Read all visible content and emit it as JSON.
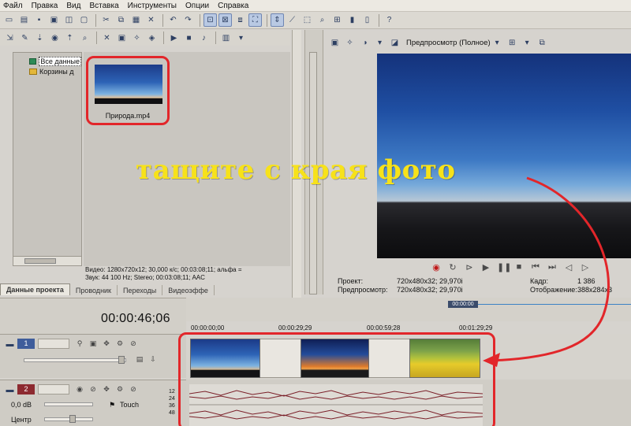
{
  "menu": [
    "Файл",
    "Правка",
    "Вид",
    "Вставка",
    "Инструменты",
    "Опции",
    "Справка"
  ],
  "explorer": {
    "tree": [
      "Все данные",
      "Корзины д"
    ],
    "media_file": "Природа.mp4",
    "video_info": "Видео: 1280x720x12; 30,000 к/с; 00:03:08;11; альфа =",
    "audio_info": "Звук: 44 100 Hz; Stereo; 00:03:08;11; AAC",
    "tabs": [
      "Данные проекта",
      "Проводник",
      "Переходы",
      "Видеоэффе"
    ]
  },
  "preview": {
    "mode": "Предпросмотр (Полное)",
    "project_label": "Проект:",
    "project_value": "720x480x32; 29,970i",
    "preview_label": "Предпросмотр:",
    "preview_value": "720x480x32; 29,970i",
    "frame_label": "Кадр:",
    "frame_value": "1 386",
    "display_label": "Отображение:",
    "display_value": "388x284x3"
  },
  "timeline": {
    "timecode": "00:00:46;06",
    "region_marker": "00:00:00",
    "ruler": [
      "00:00:00;00",
      "00:00:29;29",
      "00:00:59;28",
      "00:01:29;29"
    ],
    "video_track_number": "1",
    "audio_track_number": "2",
    "audio_level": "0,0 dB",
    "audio_mode": "Touch",
    "audio_pan": "Центр",
    "meter_labels": [
      "12",
      "24",
      "36",
      "48"
    ]
  },
  "annotation": {
    "text": "тащите с края фото"
  },
  "colors": {
    "annotation_text": "#f7e21a",
    "highlight_red": "#e2262a",
    "video_track": "#3f5d9b",
    "audio_track": "#8d2a30"
  }
}
